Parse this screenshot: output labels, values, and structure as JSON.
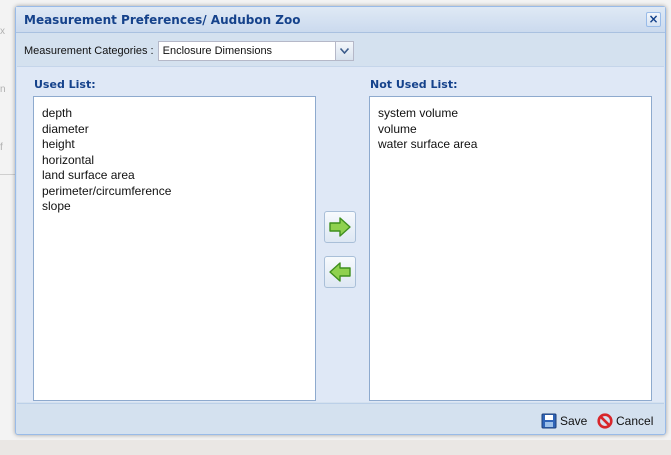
{
  "dialog": {
    "title": "Measurement Preferences/ Audubon Zoo",
    "close_symbol": "×"
  },
  "category": {
    "label": "Measurement Categories :",
    "selected": "Enclosure Dimensions"
  },
  "used_list": {
    "title": "Used List:",
    "items": [
      "depth",
      "diameter",
      "height",
      "horizontal",
      "land surface area",
      "perimeter/circumference",
      "slope"
    ]
  },
  "not_used_list": {
    "title": "Not Used List:",
    "items": [
      "system volume",
      "volume",
      "water surface area"
    ]
  },
  "buttons": {
    "move_right_icon": "right-arrow-icon",
    "move_left_icon": "left-arrow-icon",
    "save_label": "Save",
    "cancel_label": "Cancel"
  },
  "background": {
    "fragments": [
      "x",
      "n",
      "f"
    ]
  },
  "colors": {
    "title_text": "#15428b",
    "window_bg": "#d4e1ef",
    "arrow_green": "#7cc242"
  }
}
